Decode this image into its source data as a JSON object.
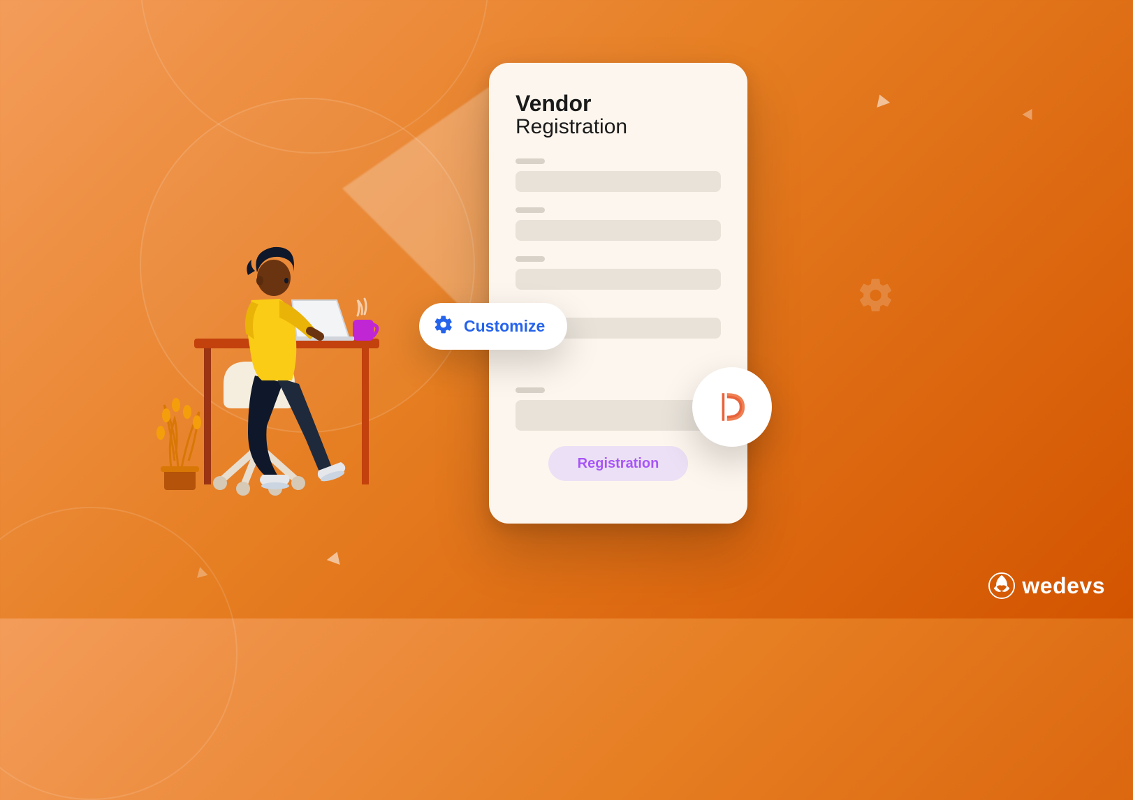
{
  "card": {
    "title_bold": "Vendor",
    "title_light": "Registration",
    "button_label": "Registration"
  },
  "customize": {
    "label": "Customize"
  },
  "brand": {
    "name": "wedevs",
    "product_letter": "D"
  },
  "icons": {
    "gear": "gear-icon",
    "dokan": "dokan-d-icon",
    "logo": "wedevs-logo-icon"
  }
}
